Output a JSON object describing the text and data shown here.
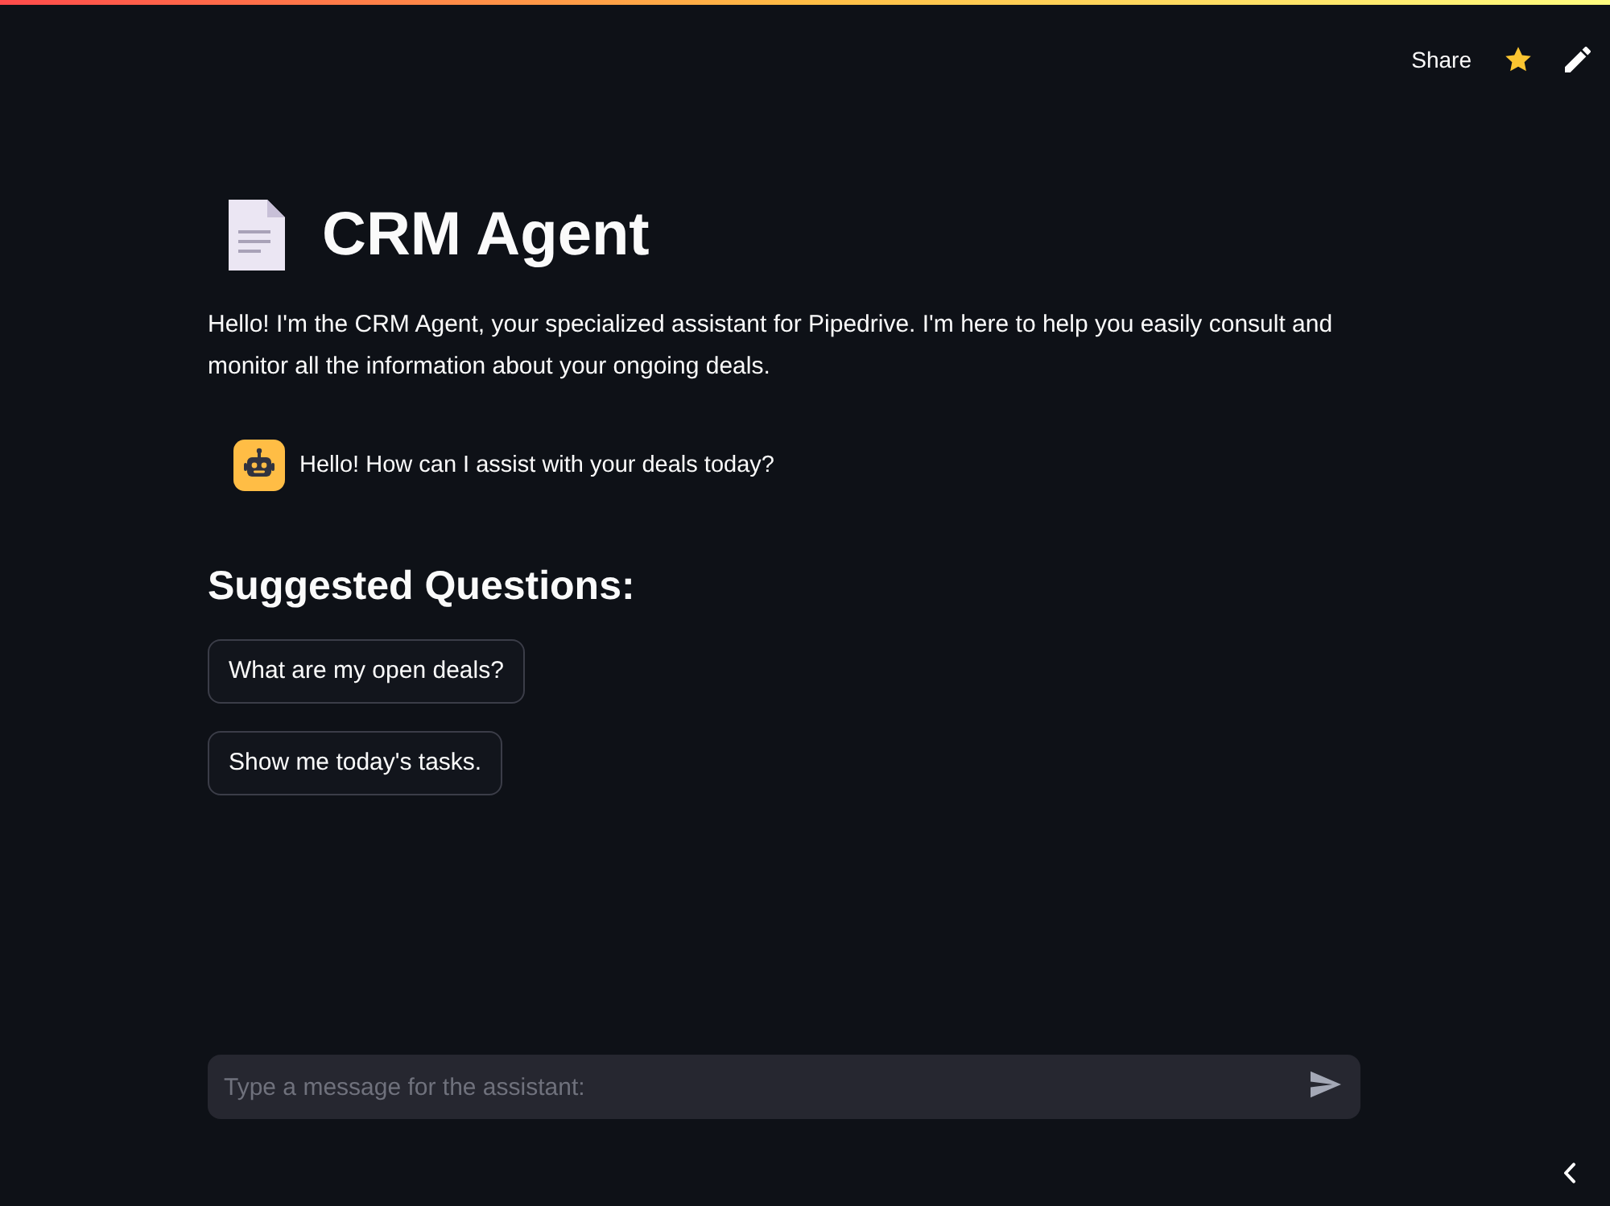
{
  "header": {
    "share": "Share"
  },
  "title": {
    "text": "CRM Agent"
  },
  "intro": "Hello! I'm the CRM Agent, your specialized assistant for Pipedrive. I'm here to help you easily consult and monitor all the information about your ongoing deals.",
  "messages": [
    {
      "kind": "assistant",
      "text": "Hello! How can I assist with your deals today?"
    }
  ],
  "suggestions": {
    "heading": "Suggested Questions:",
    "questions": [
      "What are my open deals?",
      "Show me today's tasks."
    ]
  },
  "chat_input": {
    "placeholder": "Type a message for the assistant:"
  }
}
